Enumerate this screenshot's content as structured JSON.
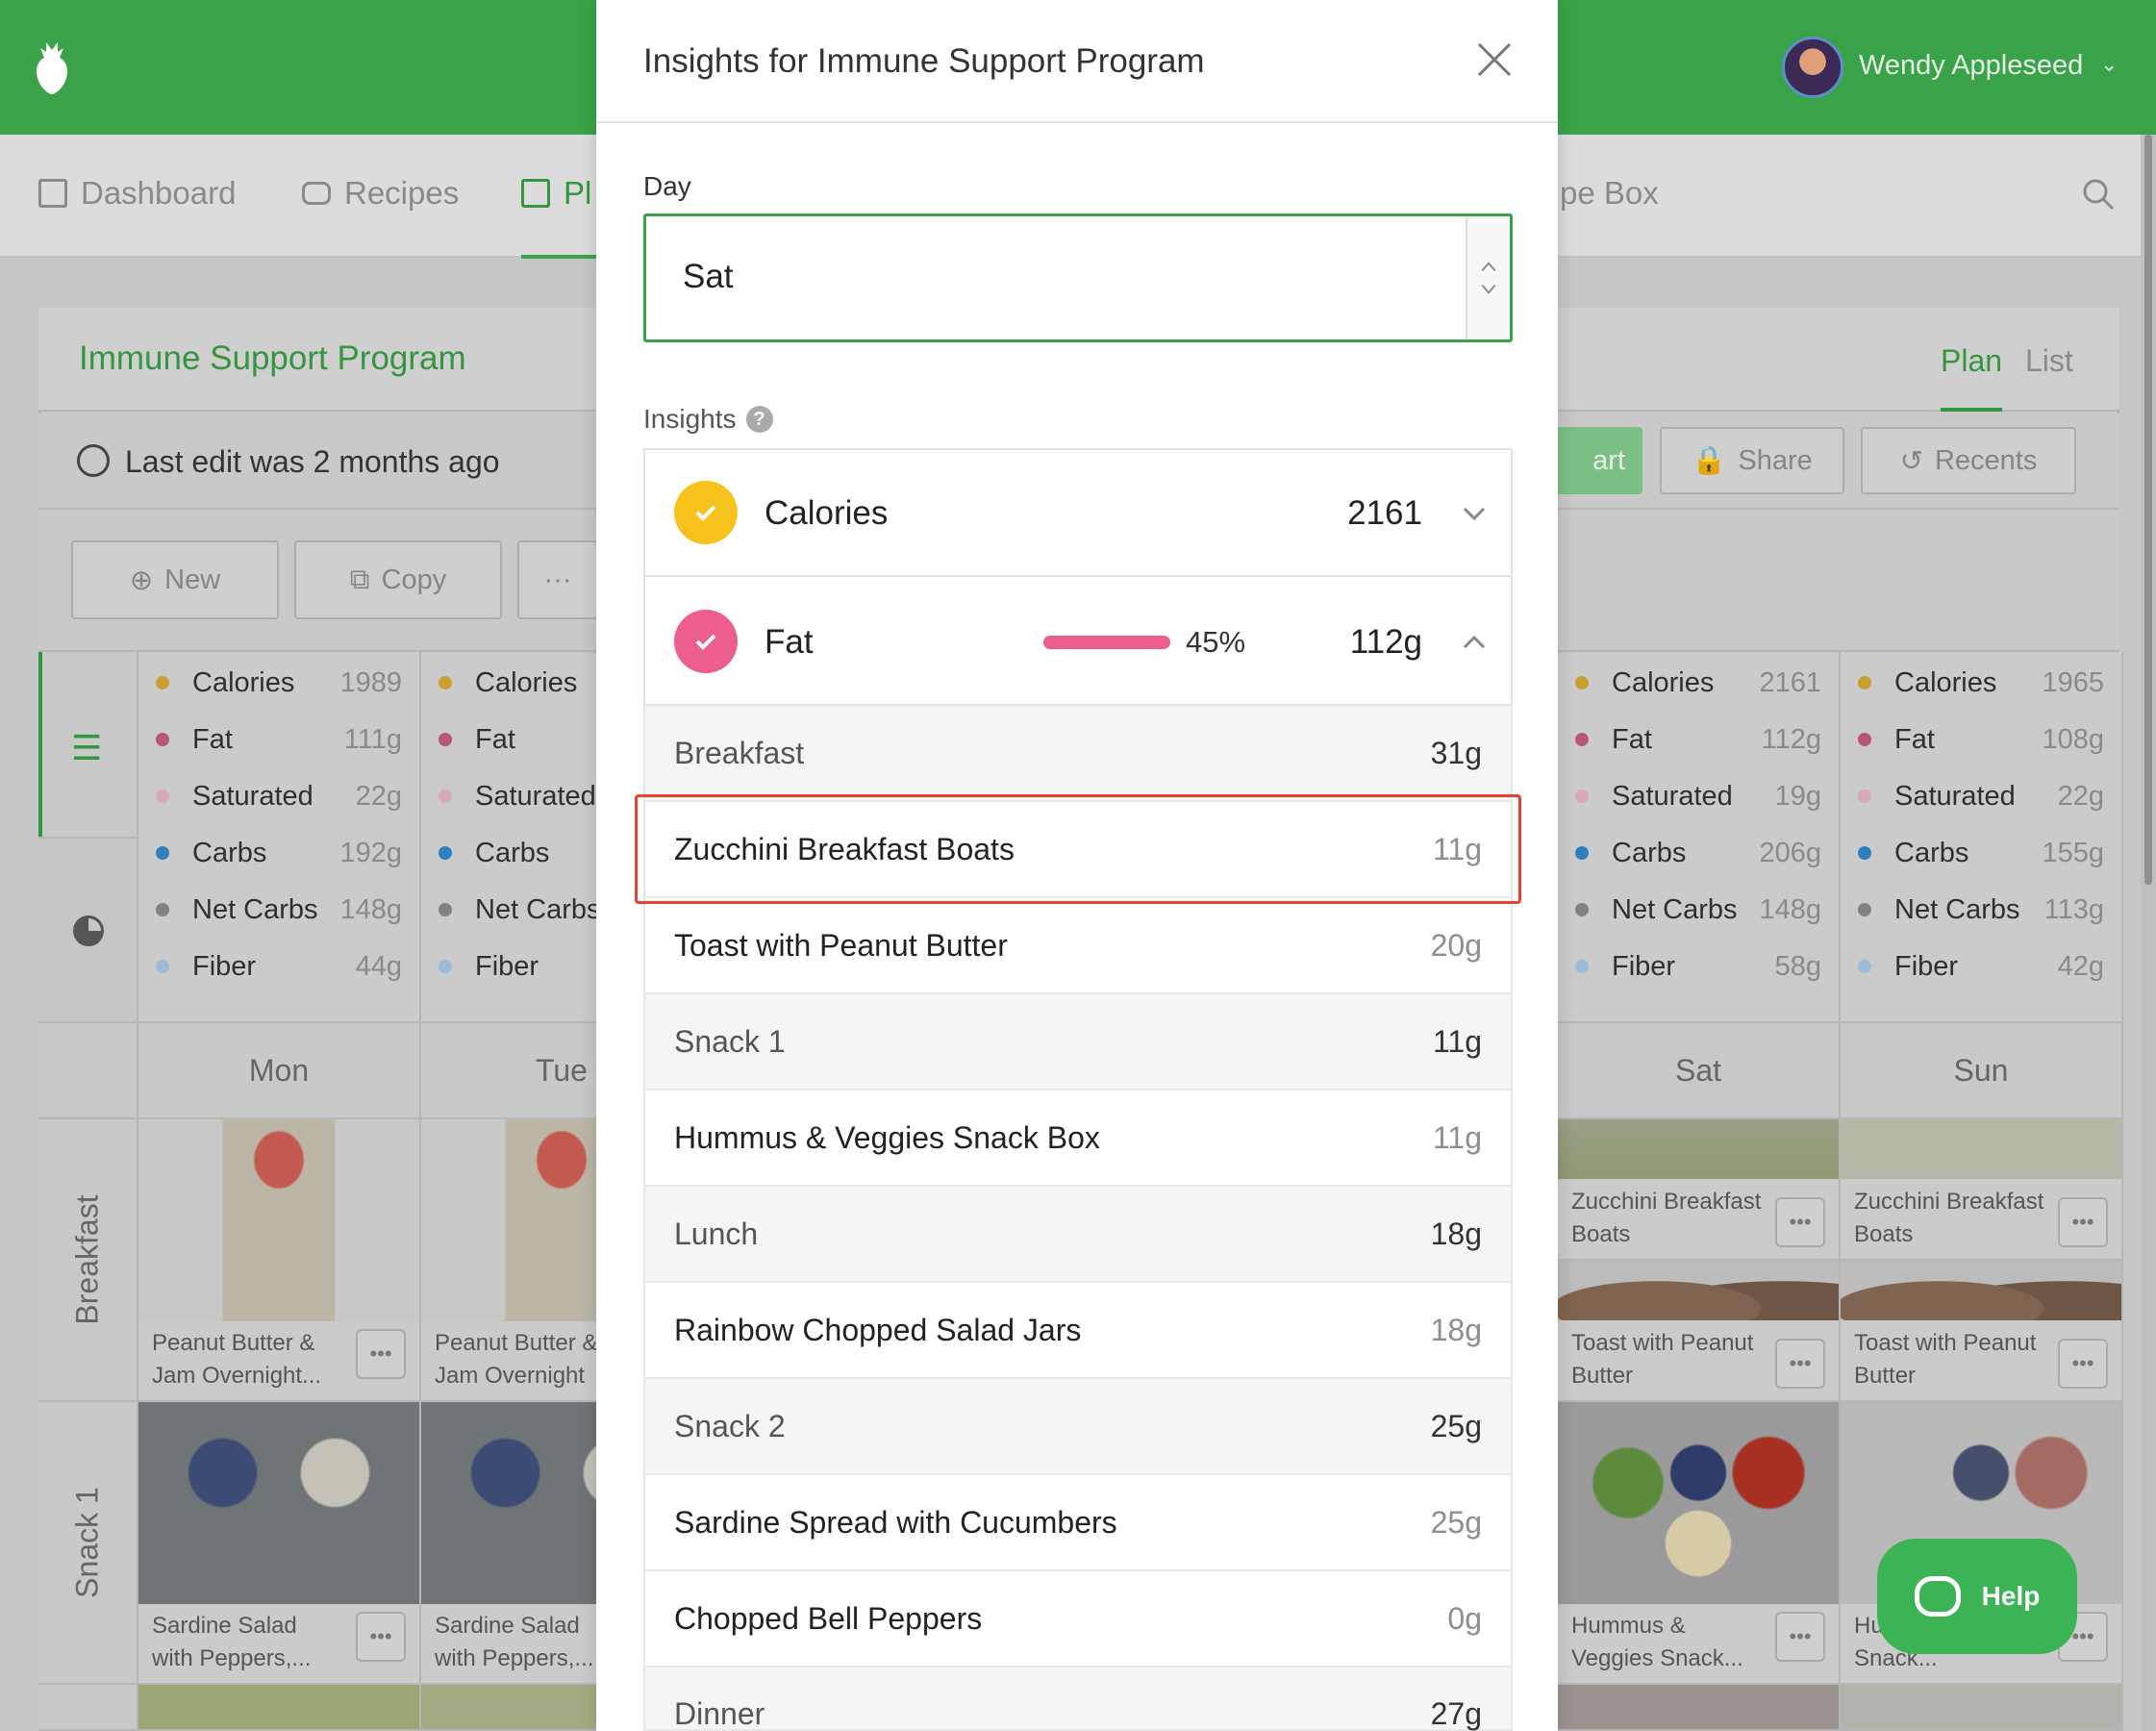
{
  "colors": {
    "brand_green": "#3aa34a",
    "fat_pink": "#eb5e8e",
    "calories_yellow": "#f7c21c",
    "carbs_blue": "#2b8bd6",
    "highlight_red": "#e8432f"
  },
  "user": {
    "name": "Wendy Appleseed"
  },
  "nav": {
    "items": [
      {
        "label": "Dashboard",
        "icon": "dashboard-icon"
      },
      {
        "label": "Recipes",
        "icon": "recipes-icon"
      },
      {
        "label": "Pl",
        "icon": "calendar-icon"
      },
      {
        "label": "pe Box",
        "icon": ""
      }
    ]
  },
  "program": {
    "title": "Immune Support Program",
    "view_plan": "Plan",
    "view_list": "List",
    "last_edit": "Last edit was 2 months ago"
  },
  "actions": {
    "cart": "art",
    "share": "Share",
    "recents": "Recents",
    "new": "New",
    "copy": "Copy",
    "more": "···"
  },
  "days": [
    {
      "name": "Mon",
      "nutrients": [
        {
          "label": "Calories",
          "value": "1989",
          "color": "#f7c21c"
        },
        {
          "label": "Fat",
          "value": "111g",
          "color": "#eb5e8e"
        },
        {
          "label": "Saturated",
          "value": "22g",
          "color": "#f0b6c9"
        },
        {
          "label": "Carbs",
          "value": "192g",
          "color": "#2b8bd6"
        },
        {
          "label": "Net Carbs",
          "value": "148g",
          "color": "#8c8c8c"
        },
        {
          "label": "Fiber",
          "value": "44g",
          "color": "#9fc9ec"
        }
      ],
      "meals": [
        {
          "name": "Peanut Butter & Jam Overnight...",
          "image": "jar"
        },
        {
          "name": "Sardine Salad with Peppers,...",
          "image": "box"
        }
      ]
    },
    {
      "name": "Tue",
      "nutrients": [
        {
          "label": "Calories",
          "value": "",
          "color": "#f7c21c"
        },
        {
          "label": "Fat",
          "value": "",
          "color": "#eb5e8e"
        },
        {
          "label": "Saturated",
          "value": "",
          "color": "#f0b6c9"
        },
        {
          "label": "Carbs",
          "value": "",
          "color": "#2b8bd6"
        },
        {
          "label": "Net Carbs",
          "value": "",
          "color": "#8c8c8c"
        },
        {
          "label": "Fiber",
          "value": "",
          "color": "#9fc9ec"
        }
      ],
      "meals": [
        {
          "name": "Peanut Butter & Jam Overnight",
          "image": "jar"
        },
        {
          "name": "Sardine Salad with Peppers,...",
          "image": "box"
        }
      ]
    },
    {
      "name": "Sat",
      "nutrients": [
        {
          "label": "Calories",
          "value": "2161",
          "color": "#f7c21c"
        },
        {
          "label": "Fat",
          "value": "112g",
          "color": "#eb5e8e"
        },
        {
          "label": "Saturated",
          "value": "19g",
          "color": "#f0b6c9"
        },
        {
          "label": "Carbs",
          "value": "206g",
          "color": "#2b8bd6"
        },
        {
          "label": "Net Carbs",
          "value": "148g",
          "color": "#8c8c8c"
        },
        {
          "label": "Fiber",
          "value": "58g",
          "color": "#9fc9ec"
        }
      ],
      "meals": [
        {
          "name": "Zucchini Breakfast Boats",
          "image": "boat"
        },
        {
          "name": "Toast with Peanut Butter",
          "image": "toast"
        },
        {
          "name": "Hummus & Veggies Snack...",
          "image": "box-sat"
        }
      ]
    },
    {
      "name": "Sun",
      "nutrients": [
        {
          "label": "Calories",
          "value": "1965",
          "color": "#f7c21c"
        },
        {
          "label": "Fat",
          "value": "108g",
          "color": "#eb5e8e"
        },
        {
          "label": "Saturated",
          "value": "22g",
          "color": "#f0b6c9"
        },
        {
          "label": "Carbs",
          "value": "155g",
          "color": "#2b8bd6"
        },
        {
          "label": "Net Carbs",
          "value": "113g",
          "color": "#8c8c8c"
        },
        {
          "label": "Fiber",
          "value": "42g",
          "color": "#9fc9ec"
        }
      ],
      "meals": [
        {
          "name": "Zucchini Breakfast Boats",
          "image": "boat"
        },
        {
          "name": "Toast with Peanut Butter",
          "image": "toast"
        },
        {
          "name": "Hu Veggies Snack...",
          "image": "box-sun"
        }
      ]
    }
  ],
  "row_labels": {
    "breakfast": "Breakfast",
    "snack1": "Snack 1"
  },
  "help": {
    "label": "Help"
  },
  "modal": {
    "title": "Insights for Immune Support Program",
    "day_label": "Day",
    "day_value": "Sat",
    "insights_label": "Insights",
    "insights_help": "?",
    "calories": {
      "name": "Calories",
      "total": "2161"
    },
    "fat": {
      "name": "Fat",
      "percent": "45%",
      "total": "112g"
    },
    "fat_breakdown": [
      {
        "name": "Breakfast",
        "value": "31g",
        "type": "group"
      },
      {
        "name": "Zucchini Breakfast Boats",
        "value": "11g",
        "type": "item"
      },
      {
        "name": "Toast with Peanut Butter",
        "value": "20g",
        "type": "item"
      },
      {
        "name": "Snack 1",
        "value": "11g",
        "type": "group"
      },
      {
        "name": "Hummus & Veggies Snack Box",
        "value": "11g",
        "type": "item"
      },
      {
        "name": "Lunch",
        "value": "18g",
        "type": "group"
      },
      {
        "name": "Rainbow Chopped Salad Jars",
        "value": "18g",
        "type": "item"
      },
      {
        "name": "Snack 2",
        "value": "25g",
        "type": "group"
      },
      {
        "name": "Sardine Spread with Cucumbers",
        "value": "25g",
        "type": "item"
      },
      {
        "name": "Chopped Bell Peppers",
        "value": "0g",
        "type": "item"
      },
      {
        "name": "Dinner",
        "value": "27g",
        "type": "group"
      }
    ]
  }
}
